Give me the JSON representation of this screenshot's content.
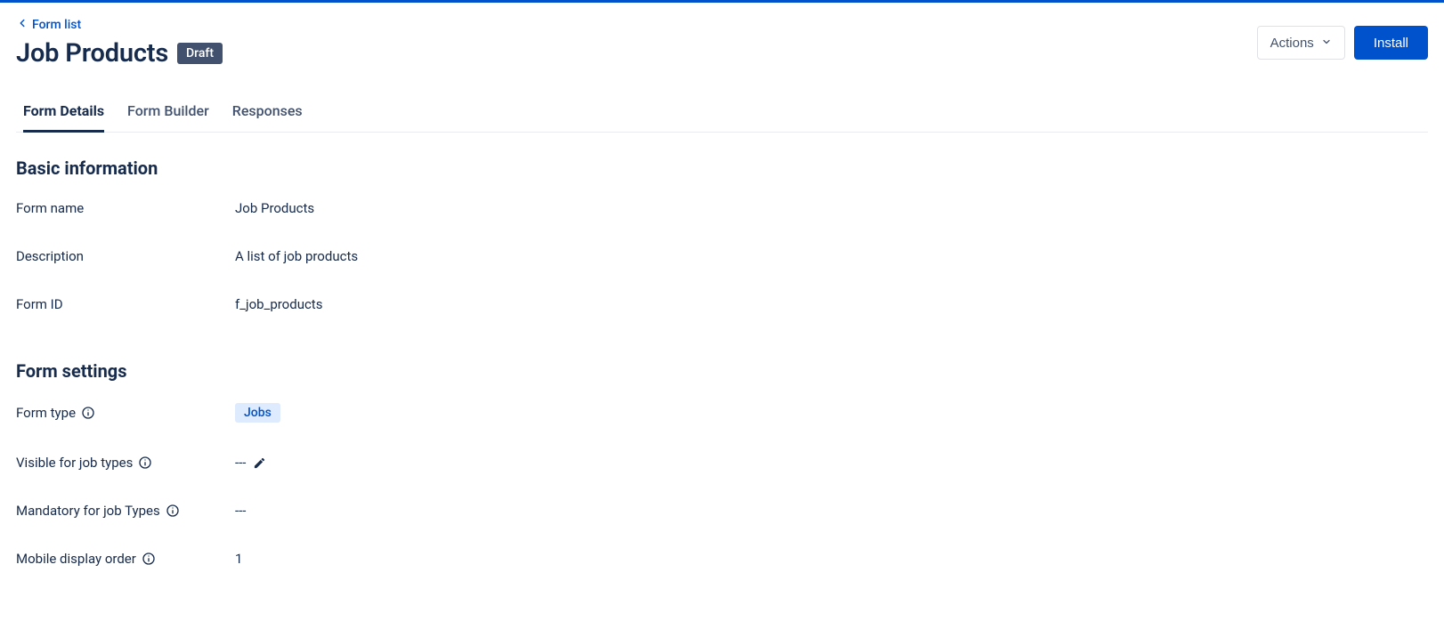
{
  "nav": {
    "back_label": "Form list"
  },
  "header": {
    "title": "Job Products",
    "status_badge": "Draft",
    "actions_label": "Actions",
    "install_label": "Install"
  },
  "tabs": [
    {
      "label": "Form Details",
      "active": true
    },
    {
      "label": "Form Builder",
      "active": false
    },
    {
      "label": "Responses",
      "active": false
    }
  ],
  "sections": {
    "basic_info": {
      "heading": "Basic information",
      "fields": {
        "form_name": {
          "label": "Form name",
          "value": "Job Products"
        },
        "description": {
          "label": "Description",
          "value": "A list of job products"
        },
        "form_id": {
          "label": "Form ID",
          "value": "f_job_products"
        }
      }
    },
    "form_settings": {
      "heading": "Form settings",
      "fields": {
        "form_type": {
          "label": "Form type",
          "value": "Jobs"
        },
        "visible_types": {
          "label": "Visible for job types",
          "value": "---"
        },
        "mandatory_types": {
          "label": "Mandatory for job Types",
          "value": "---"
        },
        "mobile_order": {
          "label": "Mobile display order",
          "value": "1"
        }
      }
    }
  }
}
